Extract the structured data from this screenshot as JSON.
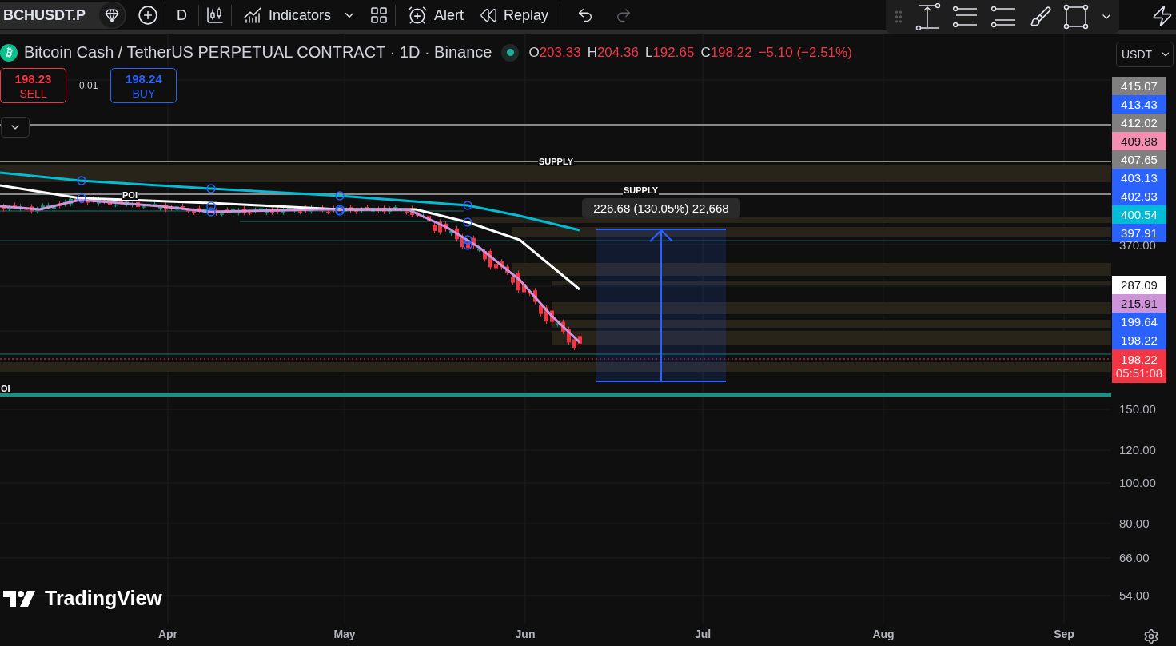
{
  "toolbar": {
    "symbol": "BCHUSDT.P",
    "interval": "D",
    "indicators": "Indicators",
    "alert": "Alert",
    "replay": "Replay"
  },
  "legend": {
    "title": "Bitcoin Cash / TetherUS PERPETUAL CONTRACT · 1D · Binance",
    "ohlc": [
      {
        "label": "O",
        "value": "203.33"
      },
      {
        "label": "H",
        "value": "204.36"
      },
      {
        "label": "L",
        "value": "192.65"
      },
      {
        "label": "C",
        "value": "198.22"
      }
    ],
    "change": "−5.10 (−2.51%)"
  },
  "trade": {
    "sell_price": "198.23",
    "sell": "SELL",
    "spread": "0.01",
    "buy_price": "198.24",
    "buy": "BUY"
  },
  "currency": "USDT",
  "price_axis": [
    {
      "text": "415.07",
      "kind": "tag",
      "color": "#808080"
    },
    {
      "text": "413.43",
      "kind": "tag",
      "color": "#2962ff"
    },
    {
      "text": "412.02",
      "kind": "tag",
      "color": "#808080"
    },
    {
      "text": "409.88",
      "kind": "tag",
      "color": "#f48fb1"
    },
    {
      "text": "407.65",
      "kind": "tag",
      "color": "#808080"
    },
    {
      "text": "403.13",
      "kind": "tag",
      "color": "#2962ff"
    },
    {
      "text": "402.93",
      "kind": "tag",
      "color": "#2962ff"
    },
    {
      "text": "400.54",
      "kind": "tag",
      "color": "#00bcd4"
    },
    {
      "text": "397.91",
      "kind": "tag",
      "color": "#2962ff"
    },
    {
      "text": "370.00",
      "kind": "tick"
    },
    {
      "text": "287.09",
      "kind": "tag",
      "color": "#ffffff"
    },
    {
      "text": "215.91",
      "kind": "tag",
      "color": "#ce93d8"
    },
    {
      "text": "199.64",
      "kind": "tag",
      "color": "#2962ff"
    },
    {
      "text": "198.22",
      "kind": "tag",
      "color": "#2962ff"
    },
    {
      "text": "198.22",
      "kind": "current",
      "countdown": "05:51:08",
      "color": "#f23645"
    },
    {
      "text": "150.00",
      "kind": "tick"
    },
    {
      "text": "120.00",
      "kind": "tick"
    },
    {
      "text": "100.00",
      "kind": "tick"
    },
    {
      "text": "80.00",
      "kind": "tick"
    },
    {
      "text": "66.00",
      "kind": "tick"
    },
    {
      "text": "54.00",
      "kind": "tick"
    }
  ],
  "chart_labels": [
    {
      "text": "SUPPLY"
    },
    {
      "text": "SUPPLY"
    },
    {
      "text": "POI"
    },
    {
      "text": "OI"
    }
  ],
  "measure": {
    "text": "226.68 (130.05%) 22,668"
  },
  "logo": "TradingView",
  "time_axis": [
    "Apr",
    "May",
    "Jun",
    "Jul",
    "Aug",
    "Sep"
  ]
}
